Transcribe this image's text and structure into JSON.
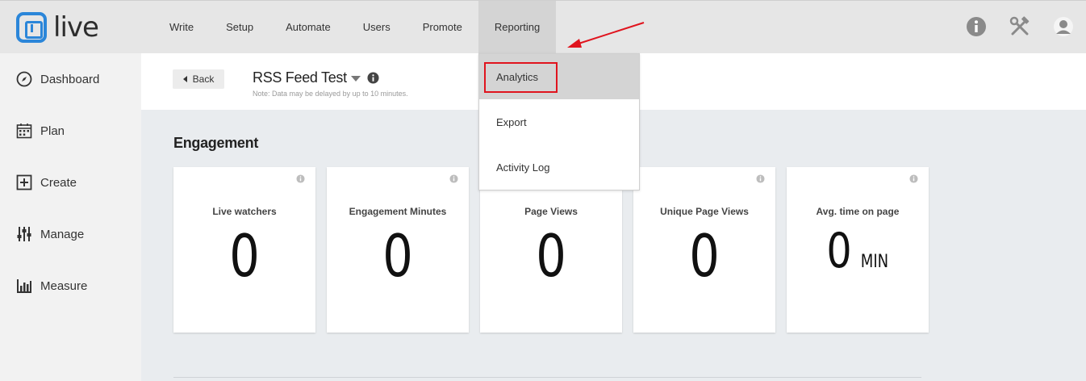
{
  "app": {
    "logo_text": "live"
  },
  "nav": {
    "items": [
      {
        "label": "Write"
      },
      {
        "label": "Setup"
      },
      {
        "label": "Automate"
      },
      {
        "label": "Users"
      },
      {
        "label": "Promote"
      },
      {
        "label": "Reporting"
      }
    ],
    "active": "Reporting"
  },
  "top_icons": [
    "info-icon",
    "tools-icon",
    "user-avatar-icon"
  ],
  "sidebar": {
    "items": [
      {
        "label": "Dashboard",
        "icon": "compass-icon"
      },
      {
        "label": "Plan",
        "icon": "calendar-icon"
      },
      {
        "label": "Create",
        "icon": "plus-square-icon"
      },
      {
        "label": "Manage",
        "icon": "sliders-icon"
      },
      {
        "label": "Measure",
        "icon": "bar-chart-icon"
      }
    ]
  },
  "header": {
    "back_label": "Back",
    "title": "RSS Feed Test",
    "note": "Note: Data may be delayed by up to 10 minutes."
  },
  "engagement": {
    "title": "Engagement",
    "cards": [
      {
        "label": "Live watchers",
        "value": "0"
      },
      {
        "label": "Engagement Minutes",
        "value": "0"
      },
      {
        "label": "Page Views",
        "value": "0"
      },
      {
        "label": "Unique Page Views",
        "value": "0"
      },
      {
        "label": "Avg. time on page",
        "value": "0",
        "unit": "MIN"
      }
    ]
  },
  "dropdown": {
    "items": [
      {
        "label": "Analytics"
      },
      {
        "label": "Export"
      },
      {
        "label": "Activity Log"
      }
    ],
    "highlighted": "Analytics"
  },
  "colors": {
    "brand": "#2b86d9",
    "highlight_box": "#e0141e",
    "annotation_arrow": "#e0141e"
  }
}
